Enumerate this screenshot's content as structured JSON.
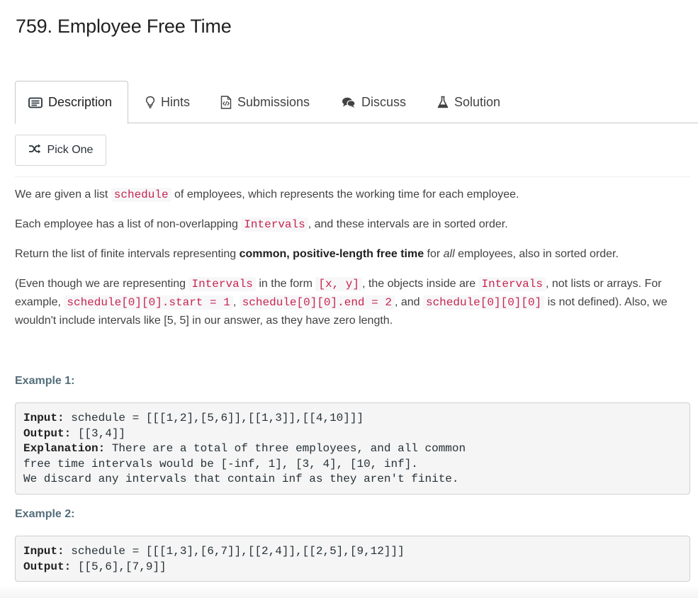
{
  "problem": {
    "title": "759. Employee Free Time"
  },
  "tabs": [
    {
      "label": "Description",
      "icon": "description-icon",
      "active": true
    },
    {
      "label": "Hints",
      "icon": "lightbulb-icon"
    },
    {
      "label": "Submissions",
      "icon": "code-file-icon"
    },
    {
      "label": "Discuss",
      "icon": "chat-bubbles-icon"
    },
    {
      "label": "Solution",
      "icon": "flask-icon"
    }
  ],
  "pick_one": {
    "label": "Pick One",
    "icon": "shuffle-icon"
  },
  "description": {
    "p1": {
      "before": "We are given a list ",
      "code": "schedule",
      "after": " of employees, which represents the working time for each employee."
    },
    "p2": {
      "before": "Each employee has a list of non-overlapping ",
      "code": "Intervals",
      "after": ", and these intervals are in sorted order."
    },
    "p3": {
      "before": "Return the list of finite intervals representing ",
      "bold": "common, positive-length free time",
      "mid": " for ",
      "italic": "all",
      "after": " employees, also in sorted order."
    },
    "p4": {
      "t1": "(Even though we are representing ",
      "c1": "Intervals",
      "t2": " in the form ",
      "c2": "[x, y]",
      "t3": ", the objects inside are ",
      "c3": "Intervals",
      "t4": ", not lists or arrays. For example, ",
      "c4": "schedule[0][0].start = 1",
      "t5": ", ",
      "c5": "schedule[0][0].end = 2",
      "t6": ", and ",
      "c6": "schedule[0][0][0]",
      "t7": " is not defined).  Also, we wouldn't include intervals like [5, 5] in our answer, as they have zero length."
    }
  },
  "examples": [
    {
      "heading": "Example 1:",
      "input_label": "Input:",
      "input": " schedule = [[[1,2],[5,6]],[[1,3]],[[4,10]]]",
      "output_label": "Output:",
      "output": " [[3,4]]",
      "explanation_label": "Explanation:",
      "explanation_lines": [
        " There are a total of three employees, and all common",
        "free time intervals would be [-inf, 1], [3, 4], [10, inf].",
        "We discard any intervals that contain inf as they aren't finite."
      ]
    },
    {
      "heading": "Example 2:",
      "input_label": "Input:",
      "input": " schedule = [[[1,3],[6,7]],[[2,4]],[[2,5],[9,12]]]",
      "output_label": "Output:",
      "output": " [[5,6],[7,9]]"
    }
  ]
}
